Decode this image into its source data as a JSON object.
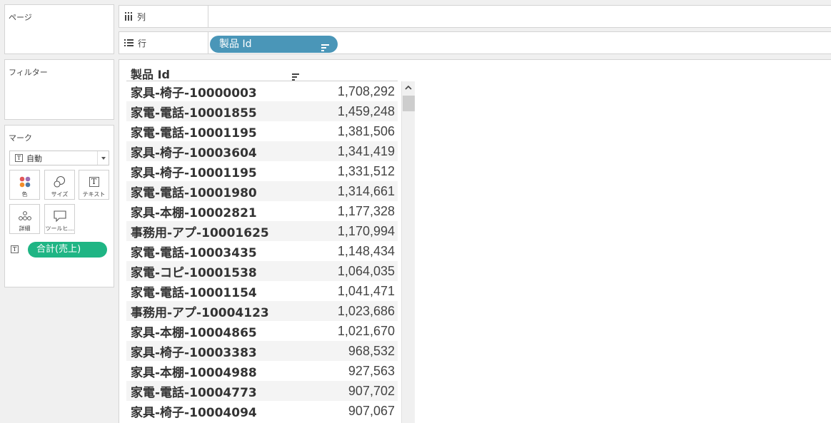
{
  "panels": {
    "pages_title": "ページ",
    "filters_title": "フィルター",
    "marks_title": "マーク"
  },
  "marks": {
    "type_label": "自動",
    "buttons": {
      "color": "色",
      "size": "サイズ",
      "text": "テキスト",
      "detail": "詳細",
      "tooltip": "ツールヒ…"
    },
    "field_pill": "合計(売上)"
  },
  "shelves": {
    "columns_label": "列",
    "rows_label": "行",
    "rows_pill": "製品 Id"
  },
  "table": {
    "header": "製品 Id",
    "rows": [
      {
        "name": "家具-椅子-10000003",
        "value": "1,708,292"
      },
      {
        "name": "家電-電話-10001855",
        "value": "1,459,248"
      },
      {
        "name": "家電-電話-10001195",
        "value": "1,381,506"
      },
      {
        "name": "家具-椅子-10003604",
        "value": "1,341,419"
      },
      {
        "name": "家具-椅子-10001195",
        "value": "1,331,512"
      },
      {
        "name": "家電-電話-10001980",
        "value": "1,314,661"
      },
      {
        "name": "家具-本棚-10002821",
        "value": "1,177,328"
      },
      {
        "name": "事務用-アプ-10001625",
        "value": "1,170,994"
      },
      {
        "name": "家電-電話-10003435",
        "value": "1,148,434"
      },
      {
        "name": "家電-コピ-10001538",
        "value": "1,064,035"
      },
      {
        "name": "家電-電話-10001154",
        "value": "1,041,471"
      },
      {
        "name": "事務用-アプ-10004123",
        "value": "1,023,686"
      },
      {
        "name": "家具-本棚-10004865",
        "value": "1,021,670"
      },
      {
        "name": "家具-椅子-10003383",
        "value": "968,532"
      },
      {
        "name": "家具-本棚-10004988",
        "value": "927,563"
      },
      {
        "name": "家電-電話-10004773",
        "value": "907,702"
      },
      {
        "name": "家具-椅子-10004094",
        "value": "907,067"
      }
    ]
  },
  "colors": {
    "dimension_pill": "#4a96b8",
    "measure_pill": "#1fb584"
  }
}
